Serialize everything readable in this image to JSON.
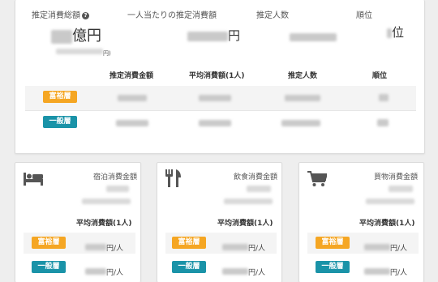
{
  "summary": {
    "labels": {
      "total": "推定消費総額",
      "per_person": "一人当たりの推定消費額",
      "people": "推定人数",
      "rank": "順位"
    },
    "help_glyph": "?",
    "values": {
      "total_unit": "億円",
      "total_sub_unit": "円)",
      "per_person_unit": "円",
      "rank_unit": "位"
    },
    "table": {
      "headers": [
        "推定消費金額",
        "平均消費額(1人)",
        "推定人数",
        "順位"
      ],
      "rows": [
        {
          "label": "富裕層"
        },
        {
          "label": "一般層"
        }
      ]
    }
  },
  "categories": [
    {
      "icon": "bed-icon",
      "title": "宿泊消費金額",
      "avg_label": "平均消費額(1人)",
      "rows": [
        {
          "label": "富裕層",
          "unit": "円/人"
        },
        {
          "label": "一般層",
          "unit": "円/人"
        }
      ]
    },
    {
      "icon": "fork-knife-icon",
      "title": "飲食消費金額",
      "avg_label": "平均消費額(1人)",
      "rows": [
        {
          "label": "富裕層",
          "unit": "円/人"
        },
        {
          "label": "一般層",
          "unit": "円/人"
        }
      ]
    },
    {
      "icon": "shopping-cart-icon",
      "title": "買物消費金額",
      "avg_label": "平均消費額(1人)",
      "rows": [
        {
          "label": "富裕層",
          "unit": "円/人"
        },
        {
          "label": "一般層",
          "unit": "円/人"
        }
      ]
    }
  ],
  "colors": {
    "wealthy_badge": "#f5a623",
    "general_badge": "#1a93a8"
  }
}
